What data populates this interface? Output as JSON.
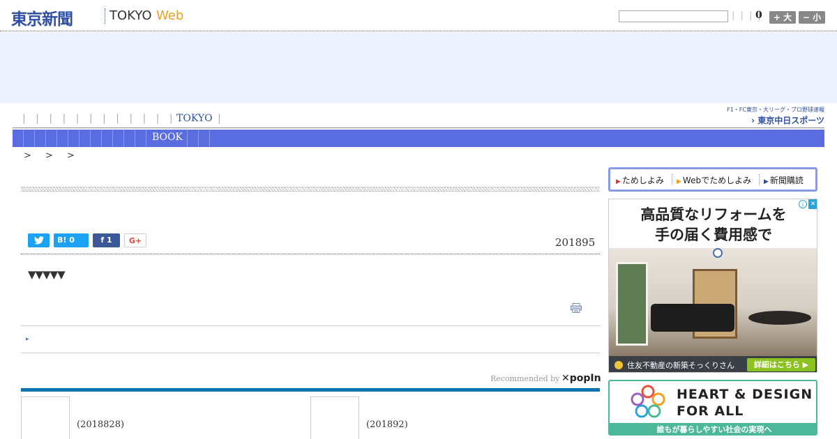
{
  "header": {
    "logo_main": "東京新聞",
    "logo_tokyo": "TOKYO",
    "logo_web": "Web",
    "search_value": "",
    "links": "| | | |",
    "count": "0",
    "font_bigger": "+ 大",
    "font_smaller": "− 小"
  },
  "nav1": {
    "separators": "| | | | | | | | | | | |",
    "tokyo_label": "TOKYO",
    "tokyo_sep": "|",
    "sports_top": "F1・FC東京・大リーグ・プロ野球速報",
    "sports_bottom": "› 東京中日スポーツ"
  },
  "nav2": {
    "book_label": "BOOK"
  },
  "breadcrumb": {
    "text": "> > >"
  },
  "article": {
    "date": "201895",
    "triangles": "▼▼▼▼▼",
    "share": {
      "twitter": "t",
      "hatena": "B! 0",
      "facebook": "f 1",
      "googleplus": "G+"
    },
    "related_arrow": "▸"
  },
  "recommended": {
    "label": "Recommended by",
    "brand": "✕popIn",
    "items": [
      {
        "text": "(2018828)"
      },
      {
        "text": "(201892)"
      }
    ]
  },
  "right_tabs": [
    {
      "label": "ためしよみ"
    },
    {
      "label": "Webでためしよみ"
    },
    {
      "label": "新聞購読"
    }
  ],
  "ad1": {
    "line1": "高品質なリフォームを",
    "line2": "手の届く費用感で",
    "foot_text": "住友不動産の新築そっくりさん",
    "cta": "詳細はこちら ▶",
    "info": "i",
    "close": "✕"
  },
  "ad2": {
    "title1": "HEART & DESIGN",
    "title2": "FOR ALL",
    "foot": "誰もが暮らしやすい社会の実現へ"
  },
  "colors": {
    "brand_blue": "#2e4fa3",
    "nav_blue": "#5a6de0",
    "accent_orange": "#e8a020",
    "rec_bar": "#0a74b0"
  }
}
